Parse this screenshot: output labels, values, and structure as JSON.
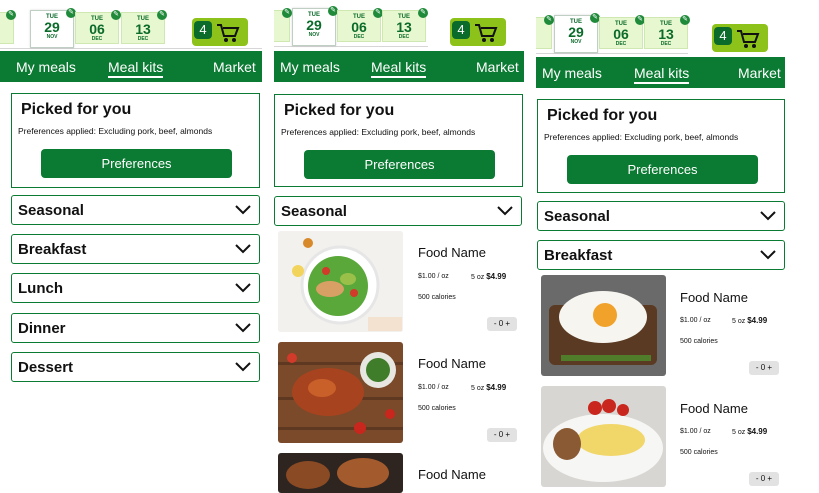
{
  "dates": [
    {
      "dow": "TUE",
      "num": "29",
      "mon": "NOV"
    },
    {
      "dow": "TUE",
      "num": "06",
      "mon": "DEC"
    },
    {
      "dow": "TUE",
      "num": "13",
      "mon": "DEC"
    }
  ],
  "date_badge": "✎",
  "cart": {
    "count": "4"
  },
  "nav": {
    "my_meals": "My meals",
    "meal_kits": "Meal kits",
    "market": "Market"
  },
  "picked": {
    "title": "Picked for you",
    "prefs_prefix": "Preferences applied: ",
    "prefs_value": "Excluding pork, beef, almonds",
    "button": "Preferences"
  },
  "categories": {
    "seasonal": "Seasonal",
    "breakfast": "Breakfast",
    "lunch": "Lunch",
    "dinner": "Dinner",
    "dessert": "Dessert"
  },
  "food": {
    "name": "Food Name",
    "price": "$1.00 / oz",
    "weight": "5 oz",
    "total": "$4.99",
    "calories": "500 calories",
    "stepper": "- 0 +"
  },
  "colors": {
    "brand": "#0b7a32",
    "accent": "#8cc21a",
    "date_bg": "#e7f7cf"
  }
}
